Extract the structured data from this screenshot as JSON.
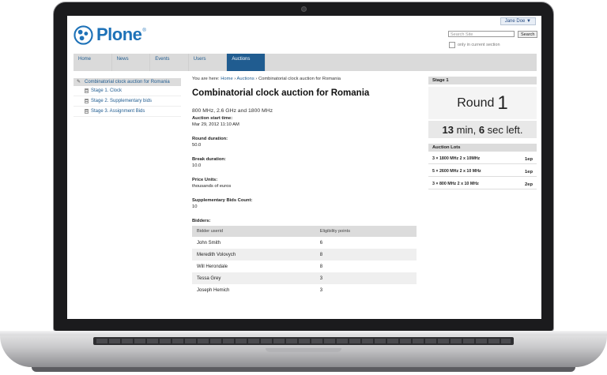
{
  "header": {
    "user_menu": "Jane Doe ▼",
    "logo_text": "Plone",
    "logo_sup": "®",
    "search_placeholder": "Search Site",
    "search_button": "Search",
    "only_current_section": "only in current section"
  },
  "nav": [
    "Home",
    "News",
    "Events",
    "Users",
    "Auctions"
  ],
  "nav_active": "Auctions",
  "sidebar": {
    "header": "Combinatorial clock auction for Romania",
    "items": [
      "Stage 1. Clock",
      "Stage 2. Supplementary bids",
      "Stage 3. Assignment Bids"
    ]
  },
  "content": {
    "breadcrumb_prefix": "You are here:",
    "breadcrumb": [
      "Home",
      "Auctions",
      "Combinatorial clock auction for Romania"
    ],
    "title": "Combinatorial clock auction for Romania",
    "description": "800 MHz, 2.6 GHz and 1800 MHz",
    "fields": [
      {
        "label": "Auction start time:",
        "value": "Mar 29, 2012 11:10 AM"
      },
      {
        "label": "Round duration:",
        "value": "50.0"
      },
      {
        "label": "Break duration:",
        "value": "10.0"
      },
      {
        "label": "Price Units:",
        "value": "thousands of euros"
      },
      {
        "label": "Supplementary Bids Count:",
        "value": "10"
      }
    ],
    "bidders_label": "Bidders:",
    "bidders_columns": [
      "Bidder userid",
      "Eligibility points"
    ],
    "bidders": [
      [
        "John Smith",
        "6"
      ],
      [
        "Meredith Volovych",
        "8"
      ],
      [
        "Will Herondale",
        "8"
      ],
      [
        "Tessa Grey",
        "3"
      ],
      [
        "Joseph Hemich",
        "3"
      ]
    ]
  },
  "stage": {
    "header": "Stage 1",
    "round_label": "Round",
    "round_number": "1",
    "time_min": "13",
    "time_min_unit": "min,",
    "time_sec": "6",
    "time_sec_unit": "sec left."
  },
  "lots": {
    "header": "Auction Lots",
    "items": [
      {
        "name": "3 × 1800 MHz 2 x 10MHz",
        "points": "1ep"
      },
      {
        "name": "5 × 2600 MHz 2 x 10 MHz",
        "points": "1ep"
      },
      {
        "name": "3 × 800 MHz 2 x 10 MHz",
        "points": "2ep"
      }
    ]
  },
  "colors": {
    "brand_blue": "#1e72b8",
    "nav_active_bg": "#205c90",
    "link": "#205c90"
  }
}
